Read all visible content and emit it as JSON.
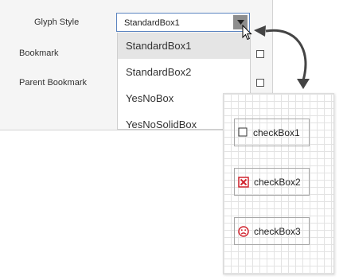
{
  "properties": {
    "glyph_style_label": "Glyph Style",
    "bookmark_label": "Bookmark",
    "parent_bookmark_label": "Parent Bookmark",
    "glyph_style_value": "StandardBox1"
  },
  "dropdown": {
    "items": [
      "StandardBox1",
      "StandardBox2",
      "YesNoBox",
      "YesNoSolidBox"
    ],
    "selected_index": 0
  },
  "design_surface": {
    "checkboxes": [
      {
        "label": "checkBox1",
        "glyph": "empty-box-icon"
      },
      {
        "label": "checkBox2",
        "glyph": "red-x-box-icon"
      },
      {
        "label": "checkBox3",
        "glyph": "sad-face-icon"
      }
    ]
  },
  "colors": {
    "combo_border": "#5b84c0",
    "selected_item": "#e5e5e5",
    "glyph_red": "#d1242f"
  }
}
